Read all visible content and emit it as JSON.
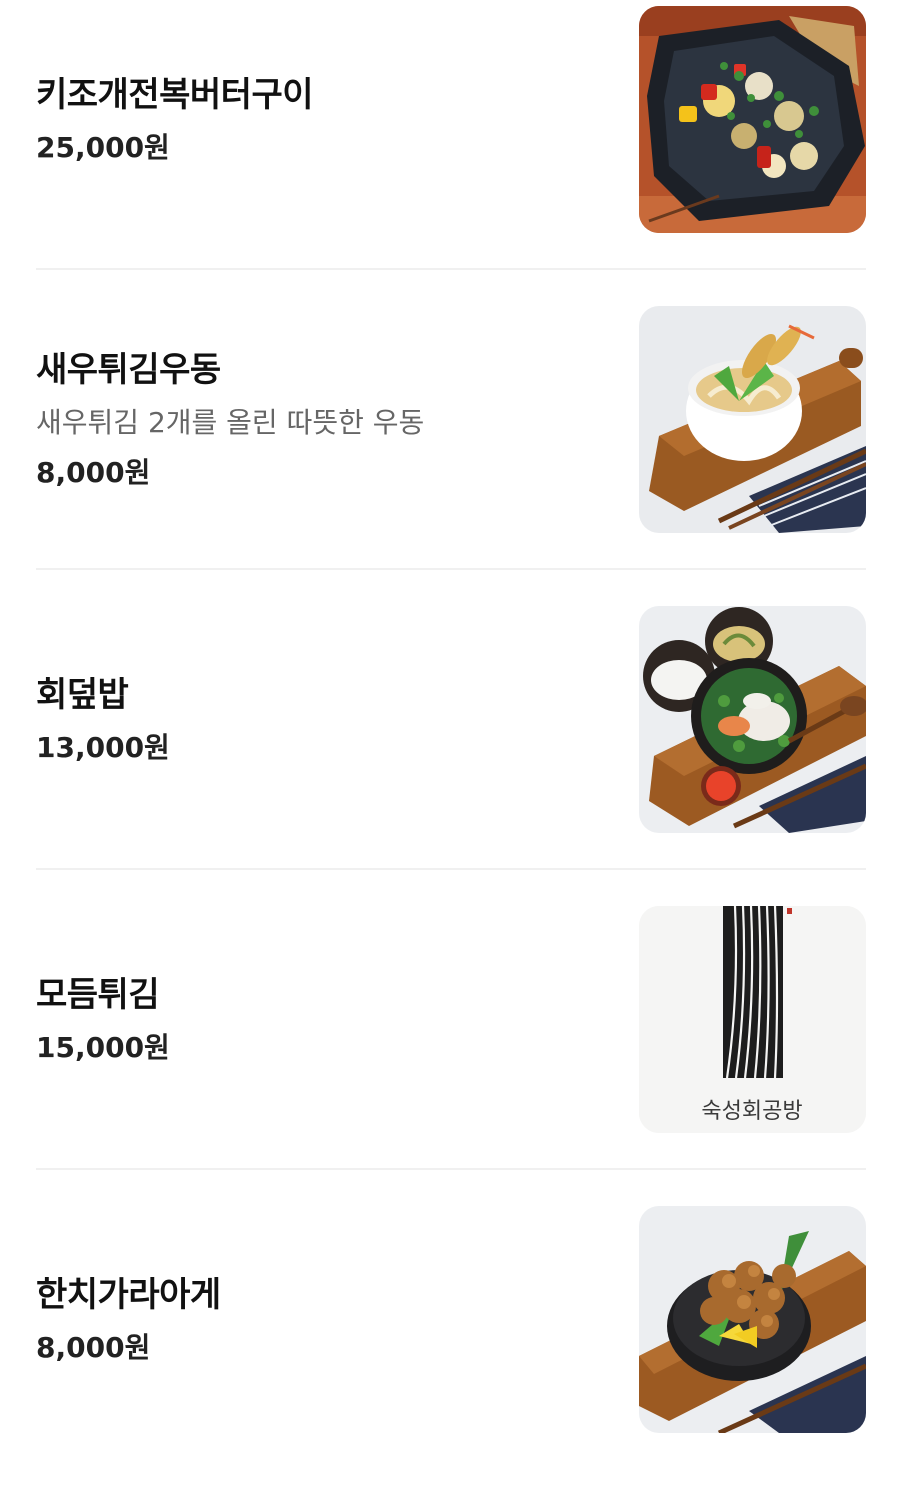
{
  "menu": {
    "items": [
      {
        "name": "키조개전복버터구이",
        "description": "",
        "price": "25,000원"
      },
      {
        "name": "새우튀김우동",
        "description": "새우튀김 2개를 올린 따뜻한 우동",
        "price": "8,000원"
      },
      {
        "name": "회덮밥",
        "description": "",
        "price": "13,000원"
      },
      {
        "name": "모듬튀김",
        "description": "",
        "price": "15,000원"
      },
      {
        "name": "한치가라아게",
        "description": "",
        "price": "8,000원"
      }
    ]
  },
  "logo": {
    "text": "숙성회공방"
  }
}
